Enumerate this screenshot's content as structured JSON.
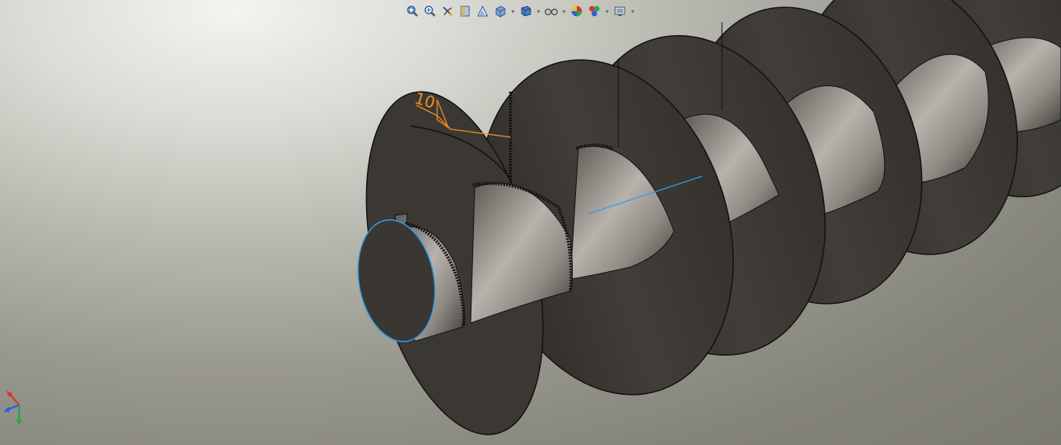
{
  "viewport": {
    "weld_annotation": "10",
    "accent_colors": {
      "weld_symbol": "#f08a24",
      "selected_edge": "#2f9ee8",
      "part_face": "#3d3a36",
      "shaft_highlight": "#a09c95"
    }
  },
  "heads_up_toolbar": {
    "buttons": [
      {
        "id": "zoom-to-fit",
        "icon": "zoom-to-fit-icon"
      },
      {
        "id": "zoom-to-area",
        "icon": "zoom-to-area-icon"
      },
      {
        "id": "previous-view",
        "icon": "previous-view-icon"
      },
      {
        "id": "section-view",
        "icon": "section-view-icon"
      },
      {
        "id": "dynamic-annotation-views",
        "icon": "dynamic-annotation-icon"
      },
      {
        "id": "view-orientation",
        "icon": "view-orientation-icon",
        "dropdown": true
      },
      {
        "id": "display-style",
        "icon": "display-style-icon",
        "dropdown": true
      },
      {
        "id": "hide-show-items",
        "icon": "hide-show-items-icon",
        "dropdown": true
      },
      {
        "id": "edit-appearance",
        "icon": "edit-appearance-icon"
      },
      {
        "id": "apply-scene",
        "icon": "apply-scene-icon",
        "dropdown": true
      },
      {
        "id": "view-settings",
        "icon": "view-settings-icon",
        "dropdown": true
      }
    ]
  },
  "triad": {
    "axes": [
      "x",
      "y",
      "z"
    ],
    "colors": {
      "x": "#d83a2e",
      "y": "#2ea24a",
      "z": "#2f5fd8"
    }
  }
}
